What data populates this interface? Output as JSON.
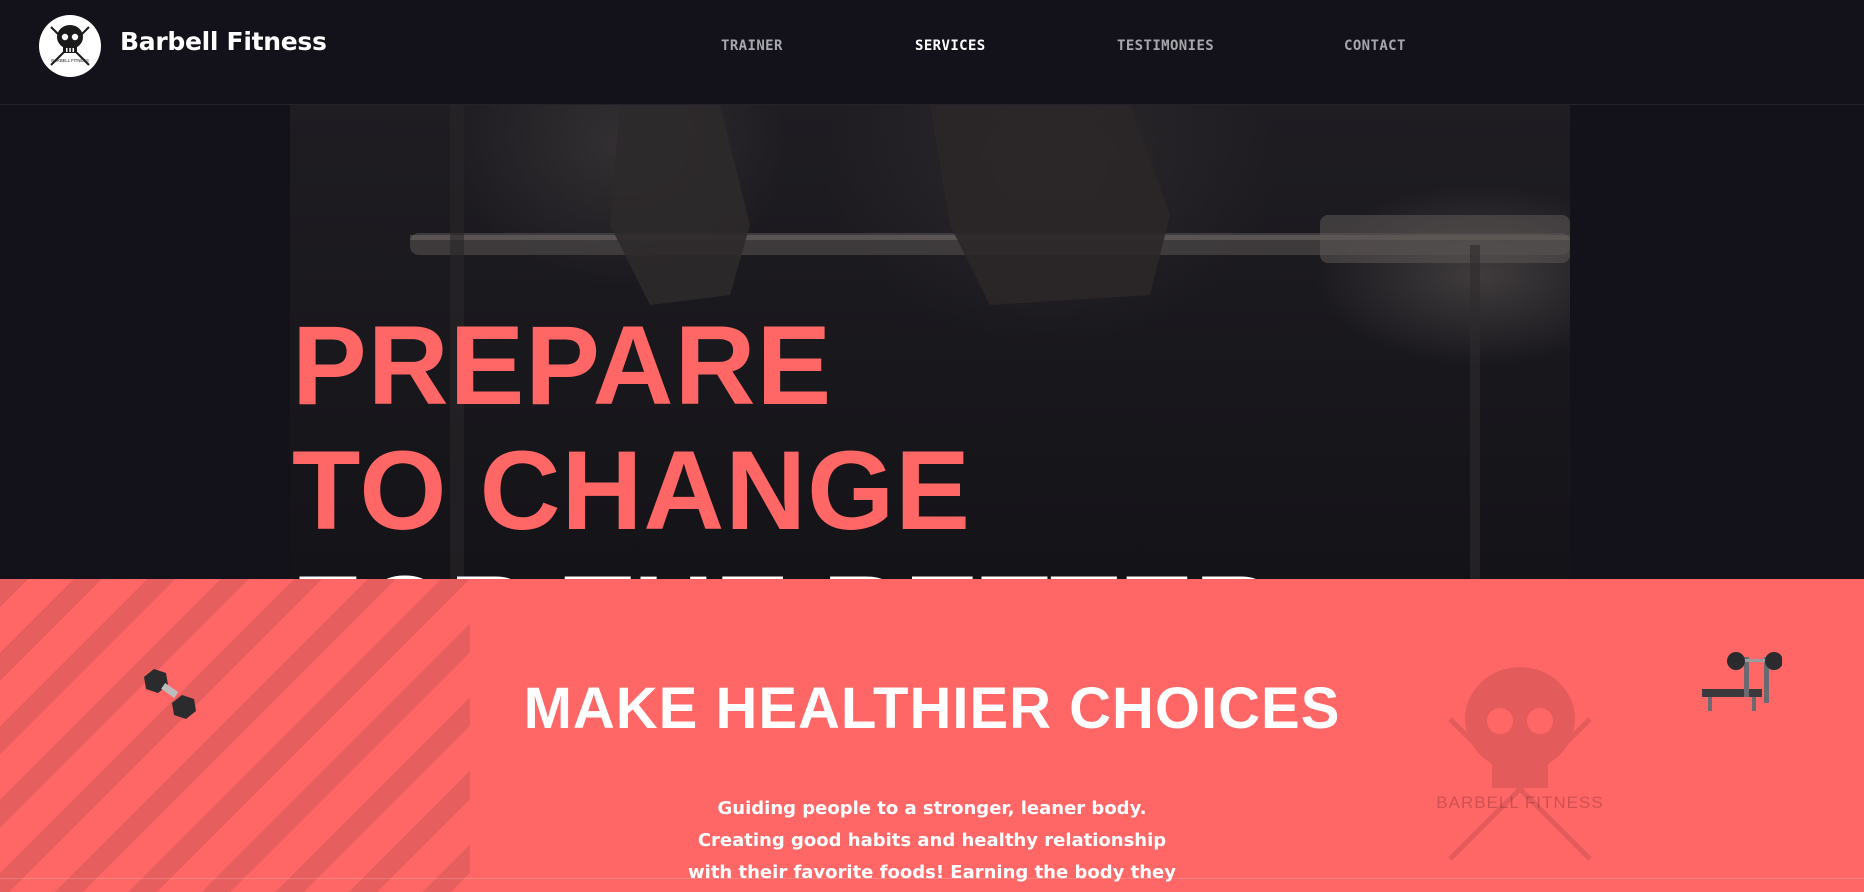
{
  "header": {
    "brand": "Barbell Fitness",
    "logo_text": "BARBELL FITNESS",
    "nav": [
      {
        "label": "TRAINER",
        "active": false
      },
      {
        "label": "SERVICES",
        "active": true
      },
      {
        "label": "TESTIMONIES",
        "active": false
      },
      {
        "label": "CONTACT",
        "active": false
      }
    ]
  },
  "hero": {
    "line1": "PREPARE",
    "line2": "TO CHANGE",
    "line3": "FOR THE BETTER."
  },
  "section": {
    "title": "MAKE HEALTHIER CHOICES",
    "body_lines": [
      "Guiding people to a stronger, leaner body.",
      "Creating good habits and healthy relationship",
      "with their favorite foods! Earning the body they"
    ],
    "watermark_text": "BARBELL FITNESS"
  },
  "colors": {
    "accent": "#ff6767",
    "background": "#13121a",
    "text": "#ffffff",
    "nav_inactive": "#a6a6ad"
  },
  "icons": [
    "skull-logo-icon",
    "dumbbell-icon",
    "weight-bench-icon",
    "skull-watermark-icon"
  ]
}
